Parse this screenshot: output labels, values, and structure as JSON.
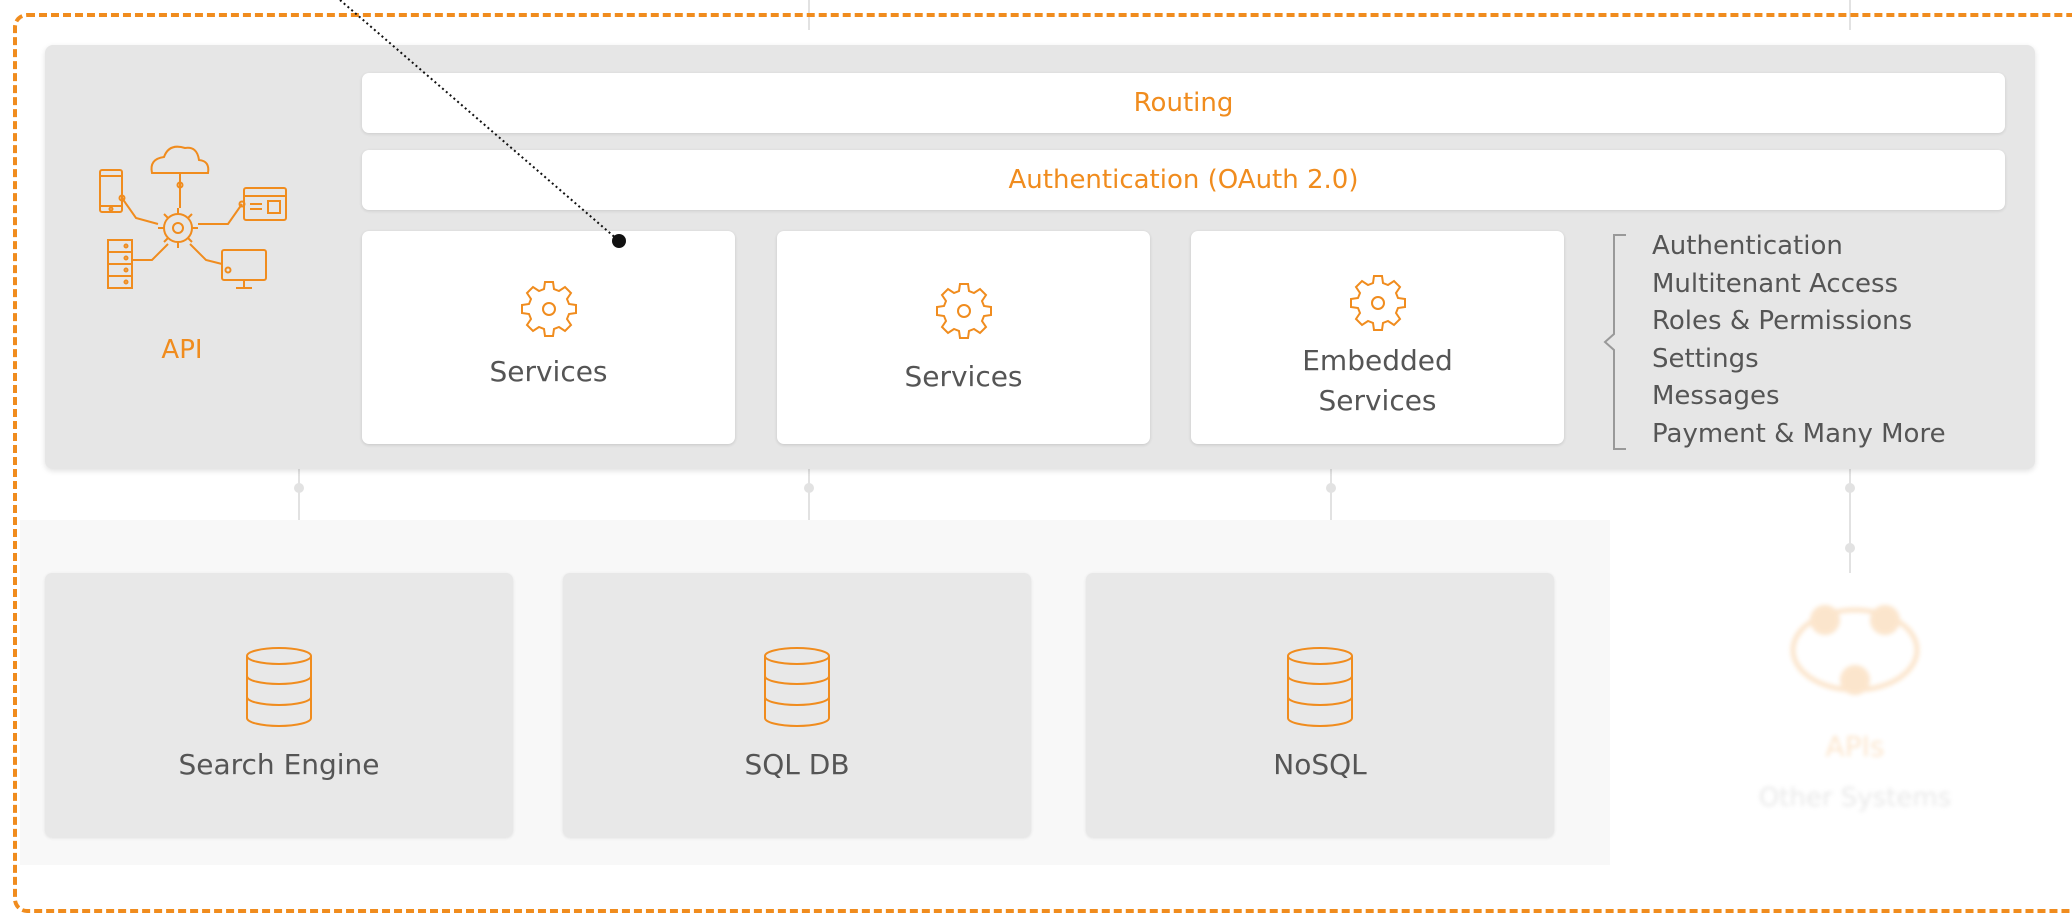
{
  "api": {
    "label": "API"
  },
  "bars": {
    "routing": "Routing",
    "authentication": "Authentication (OAuth 2.0)"
  },
  "services": [
    {
      "line1": "Services",
      "line2": ""
    },
    {
      "line1": "Services",
      "line2": ""
    },
    {
      "line1": "Embedded",
      "line2": "Services"
    }
  ],
  "features": [
    "Authentication",
    "Multitenant Access",
    "Roles & Permissions",
    "Settings",
    "Messages",
    "Payment & Many More"
  ],
  "databases": [
    {
      "label": "Search Engine"
    },
    {
      "label": "SQL DB"
    },
    {
      "label": "NoSQL"
    }
  ],
  "faded": {
    "title": "APIs",
    "subtitle": "Other Systems"
  },
  "colors": {
    "accent": "#f08c1e",
    "text": "#555555",
    "panel": "#e6e6e6"
  }
}
